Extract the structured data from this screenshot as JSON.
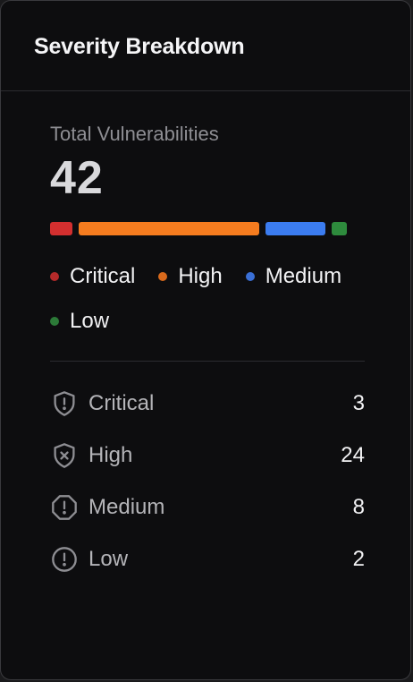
{
  "card": {
    "title": "Severity Breakdown"
  },
  "summary": {
    "label": "Total Vulnerabilities",
    "total": "42"
  },
  "severities": [
    {
      "key": "critical",
      "label": "Critical",
      "count": "3",
      "color": "#d32f2f",
      "icon": "shield-alert-icon"
    },
    {
      "key": "high",
      "label": "High",
      "count": "24",
      "color": "#f57c1f",
      "icon": "shield-x-icon"
    },
    {
      "key": "medium",
      "label": "Medium",
      "count": "8",
      "color": "#3b7cf0",
      "icon": "octagon-alert-icon"
    },
    {
      "key": "low",
      "label": "Low",
      "count": "2",
      "color": "#2e8b3d",
      "icon": "circle-alert-icon"
    }
  ],
  "legend_dot_colors": {
    "critical": "#b52a2a",
    "high": "#d96a1c",
    "medium": "#3a6fd6",
    "low": "#2c7a38"
  }
}
